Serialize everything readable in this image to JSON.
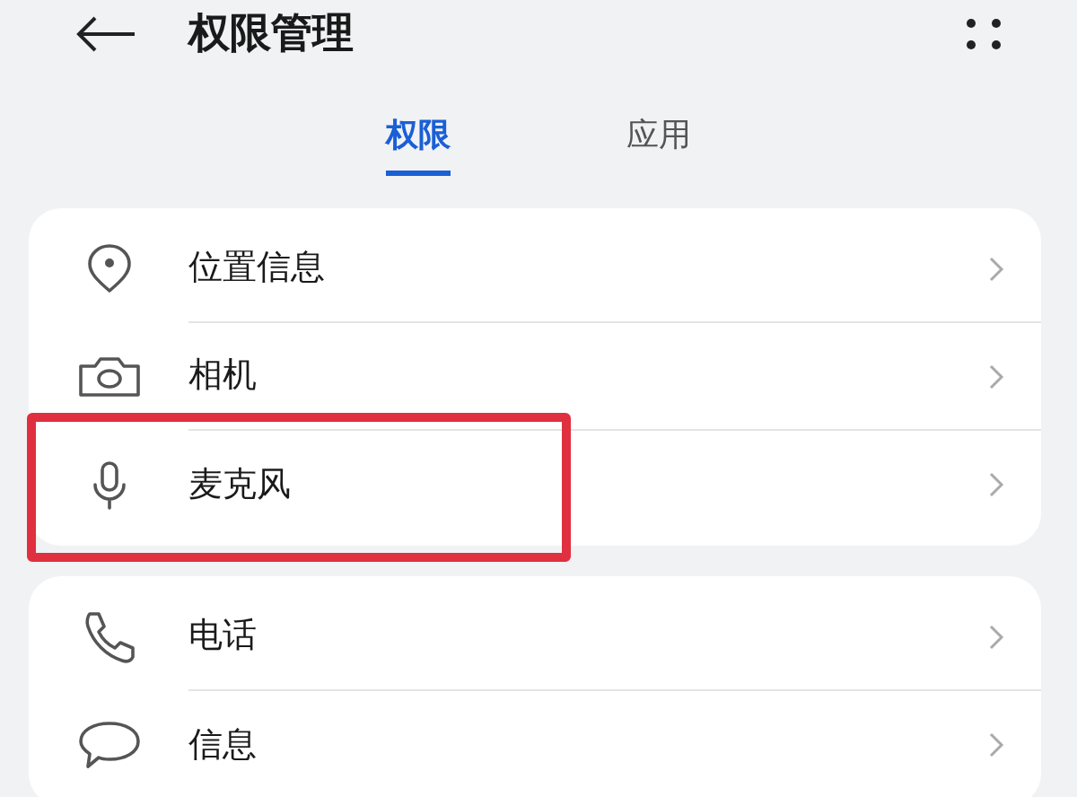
{
  "header": {
    "title": "权限管理"
  },
  "tabs": [
    {
      "label": "权限",
      "selected": true
    },
    {
      "label": "应用",
      "selected": false
    }
  ],
  "groups": [
    {
      "items": [
        {
          "kind": "location",
          "label": "位置信息",
          "highlighted": false
        },
        {
          "kind": "camera",
          "label": "相机",
          "highlighted": false
        },
        {
          "kind": "microphone",
          "label": "麦克风",
          "highlighted": true
        }
      ]
    },
    {
      "items": [
        {
          "kind": "phone",
          "label": "电话",
          "highlighted": false
        },
        {
          "kind": "message",
          "label": "信息",
          "highlighted": false
        }
      ]
    }
  ]
}
